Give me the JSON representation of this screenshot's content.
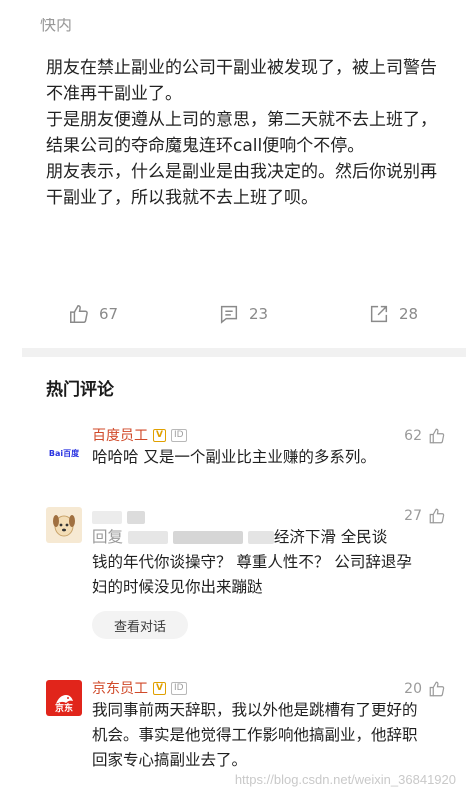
{
  "header": {
    "cut_text": "快内"
  },
  "post": {
    "paragraphs": [
      "朋友在禁止副业的公司干副业被发现了，被上司警告不准再干副业了。",
      "于是朋友便遵从上司的意思，第二天就不去上班了，结果公司的夺命魔鬼连环call便响个不停。",
      "朋友表示，什么是副业是由我决定的。然后你说别再干副业了，所以我就不去上班了呗。"
    ]
  },
  "actions": {
    "like_count": "67",
    "comment_count": "23",
    "share_count": "28"
  },
  "hot_comments": {
    "title": "热门评论",
    "items": [
      {
        "user": "百度员工",
        "avatar_text": "Bai百度",
        "badge": "V",
        "id_badge": "ID",
        "likes": "62",
        "text": "哈哈哈 又是一个副业比主业赚的多系列。"
      },
      {
        "user": "",
        "likes": "27",
        "reply_prefix": "回复",
        "text_line1_end": "经济下滑 全民谈",
        "text_rest": "钱的年代你谈操守？ 尊重人性不？  公司辞退孕妇的时候没见你出来蹦跶",
        "view_convo": "查看对话"
      },
      {
        "user": "京东员工",
        "avatar_text": "京东",
        "badge": "V",
        "id_badge": "ID",
        "likes": "20",
        "text": "我同事前两天辞职，我以外他是跳槽有了更好的机会。事实是他觉得工作影响他搞副业，他辞职回家专心搞副业去了。"
      }
    ]
  },
  "watermark": "https://blog.csdn.net/weixin_36841920",
  "colors": {
    "username": "#d04a2a",
    "badge": "#e0a000",
    "muted": "#9a9a9a",
    "jd_red": "#e1251b",
    "baidu_blue": "#2932e1",
    "baidu_red": "#e10602"
  }
}
